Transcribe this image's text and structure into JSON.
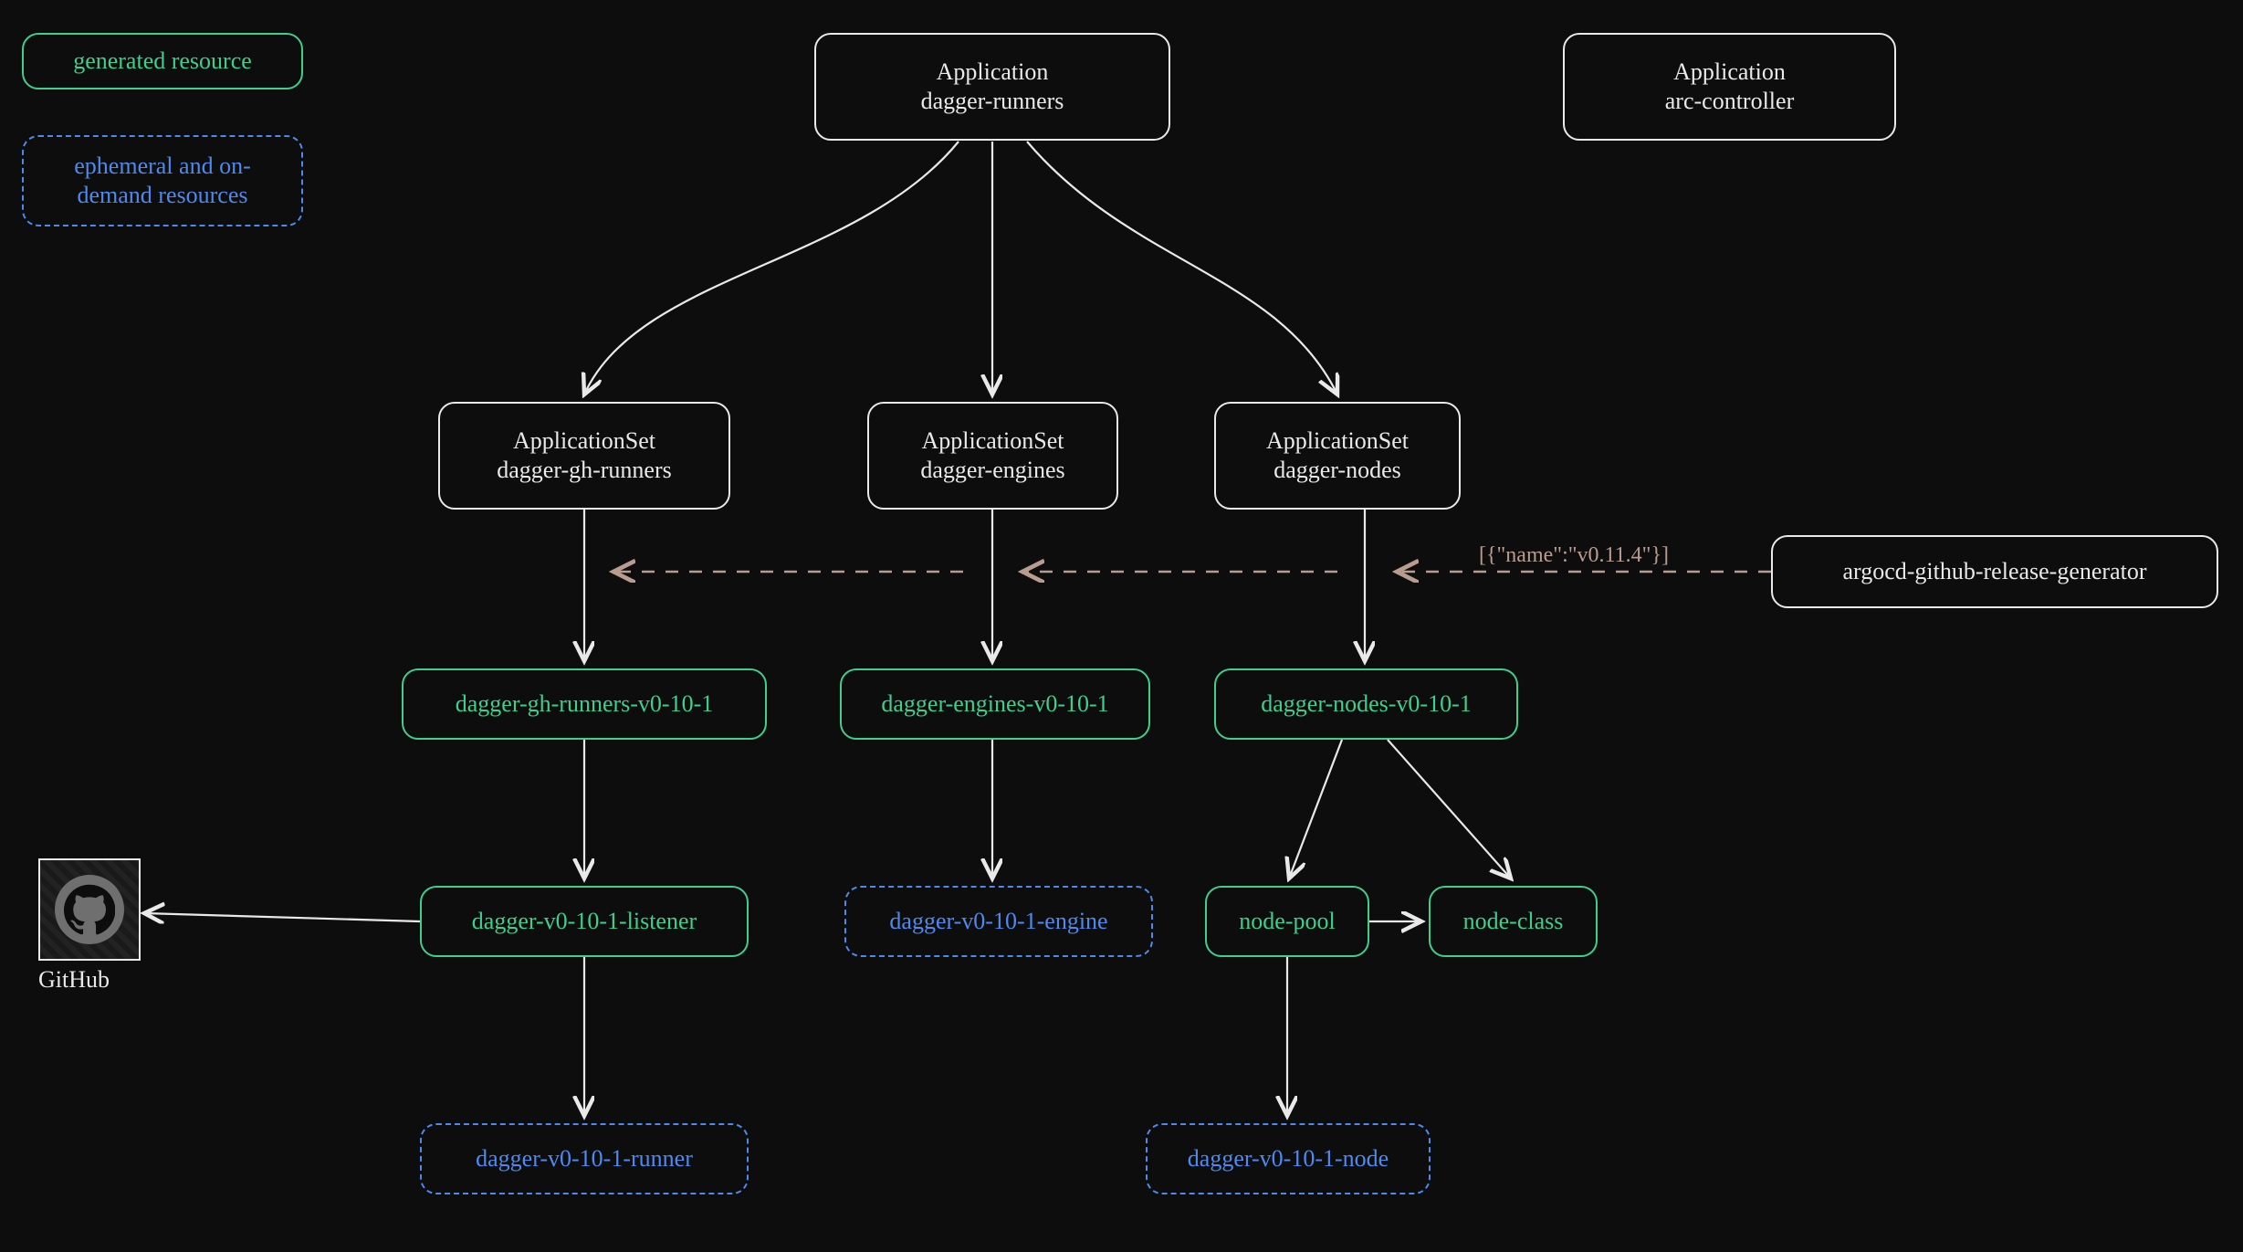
{
  "legend": {
    "generated": "generated resource",
    "ephemeral": "ephemeral and on-\ndemand resources"
  },
  "app_dagger_runners": {
    "line1": "Application",
    "line2": "dagger-runners"
  },
  "app_arc_controller": {
    "line1": "Application",
    "line2": "arc-controller"
  },
  "appset_gh_runners": {
    "line1": "ApplicationSet",
    "line2": "dagger-gh-runners"
  },
  "appset_engines": {
    "line1": "ApplicationSet",
    "line2": "dagger-engines"
  },
  "appset_nodes": {
    "line1": "ApplicationSet",
    "line2": "dagger-nodes"
  },
  "release_generator": "argocd-github-release-generator",
  "release_payload": "[{\"name\":\"v0.11.4\"}]",
  "gen_gh_runners": "dagger-gh-runners-v0-10-1",
  "gen_engines": "dagger-engines-v0-10-1",
  "gen_nodes": "dagger-nodes-v0-10-1",
  "listener": "dagger-v0-10-1-listener",
  "engine": "dagger-v0-10-1-engine",
  "node_pool": "node-pool",
  "node_class": "node-class",
  "runner": "dagger-v0-10-1-runner",
  "node": "dagger-v0-10-1-node",
  "github": "GitHub",
  "chart_data": {
    "type": "diagram",
    "nodes": [
      {
        "id": "legend-generated",
        "label": "generated resource",
        "style": "green-solid"
      },
      {
        "id": "legend-ephemeral",
        "label": "ephemeral and on-demand resources",
        "style": "blue-dashed"
      },
      {
        "id": "app-dagger-runners",
        "label": "Application dagger-runners",
        "style": "white"
      },
      {
        "id": "app-arc-controller",
        "label": "Application arc-controller",
        "style": "white"
      },
      {
        "id": "appset-gh-runners",
        "label": "ApplicationSet dagger-gh-runners",
        "style": "white"
      },
      {
        "id": "appset-engines",
        "label": "ApplicationSet dagger-engines",
        "style": "white"
      },
      {
        "id": "appset-nodes",
        "label": "ApplicationSet dagger-nodes",
        "style": "white"
      },
      {
        "id": "release-generator",
        "label": "argocd-github-release-generator",
        "style": "white"
      },
      {
        "id": "gen-gh-runners",
        "label": "dagger-gh-runners-v0-10-1",
        "style": "green-solid"
      },
      {
        "id": "gen-engines",
        "label": "dagger-engines-v0-10-1",
        "style": "green-solid"
      },
      {
        "id": "gen-nodes",
        "label": "dagger-nodes-v0-10-1",
        "style": "green-solid"
      },
      {
        "id": "listener",
        "label": "dagger-v0-10-1-listener",
        "style": "green-solid"
      },
      {
        "id": "engine",
        "label": "dagger-v0-10-1-engine",
        "style": "blue-dashed"
      },
      {
        "id": "node-pool",
        "label": "node-pool",
        "style": "green-solid"
      },
      {
        "id": "node-class",
        "label": "node-class",
        "style": "green-solid"
      },
      {
        "id": "runner",
        "label": "dagger-v0-10-1-runner",
        "style": "blue-dashed"
      },
      {
        "id": "node",
        "label": "dagger-v0-10-1-node",
        "style": "blue-dashed"
      },
      {
        "id": "github",
        "label": "GitHub",
        "style": "external"
      }
    ],
    "edges": [
      {
        "from": "app-dagger-runners",
        "to": "appset-gh-runners"
      },
      {
        "from": "app-dagger-runners",
        "to": "appset-engines"
      },
      {
        "from": "app-dagger-runners",
        "to": "appset-nodes"
      },
      {
        "from": "appset-gh-runners",
        "to": "gen-gh-runners"
      },
      {
        "from": "appset-engines",
        "to": "gen-engines"
      },
      {
        "from": "appset-nodes",
        "to": "gen-nodes"
      },
      {
        "from": "release-generator",
        "to": "appset-nodes",
        "style": "dashed",
        "label": "[{\"name\":\"v0.11.4\"}]"
      },
      {
        "from": "release-generator",
        "to": "appset-engines",
        "style": "dashed"
      },
      {
        "from": "release-generator",
        "to": "appset-gh-runners",
        "style": "dashed"
      },
      {
        "from": "gen-gh-runners",
        "to": "listener"
      },
      {
        "from": "gen-engines",
        "to": "engine"
      },
      {
        "from": "gen-nodes",
        "to": "node-pool"
      },
      {
        "from": "gen-nodes",
        "to": "node-class"
      },
      {
        "from": "node-pool",
        "to": "node-class"
      },
      {
        "from": "listener",
        "to": "runner"
      },
      {
        "from": "node-pool",
        "to": "node"
      },
      {
        "from": "listener",
        "to": "github"
      }
    ]
  }
}
